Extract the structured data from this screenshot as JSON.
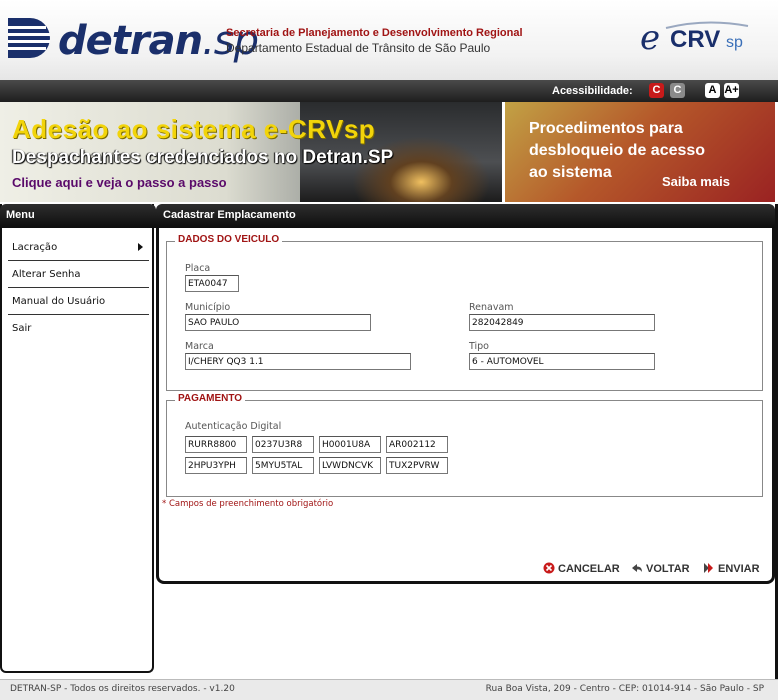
{
  "header": {
    "logo_text": "detran",
    "logo_suffix": ".sp",
    "secretaria": "Secretaria de Planejamento e Desenvolvimento Regional",
    "departamento": "Departamento Estadual de Trânsito de São Paulo",
    "ecrv_e": "e",
    "ecrv_crv": "CRV",
    "ecrv_sp": "sp"
  },
  "accessibility": {
    "label": "Acessibilidade:",
    "contrast_1": "C",
    "contrast_2": "C",
    "font_1": "A",
    "font_2": "A+"
  },
  "banners": {
    "left": {
      "line1": "Adesão ao sistema e-CRVsp",
      "line2": "Despachantes credenciados no Detran.SP",
      "line3": "Clique aqui e veja o passo a passo"
    },
    "right": {
      "line1": "Procedimentos para",
      "line2": "desbloqueio de acesso",
      "line3": "ao sistema",
      "link": "Saiba mais"
    }
  },
  "sidebar": {
    "title": "Menu",
    "items": [
      {
        "label": "Lacração",
        "has_submenu": true
      },
      {
        "label": "Alterar Senha"
      },
      {
        "label": "Manual do Usuário"
      },
      {
        "label": "Sair"
      }
    ]
  },
  "main": {
    "title": "Cadastrar Emplacamento",
    "veiculo": {
      "legend": "DADOS DO VEICULO",
      "placa_label": "Placa",
      "placa_value": "ETA0047",
      "municipio_label": "Município",
      "municipio_value": "SAO PAULO",
      "renavam_label": "Renavam",
      "renavam_value": "282042849",
      "marca_label": "Marca",
      "marca_value": "I/CHERY QQ3 1.1",
      "tipo_label": "Tipo",
      "tipo_value": "6 - AUTOMOVEL"
    },
    "pagamento": {
      "legend": "PAGAMENTO",
      "auth_label": "Autenticação Digital",
      "auth_values": [
        "RURR8800",
        "0237U3R8",
        "H0001U8A",
        "AR002112",
        "2HPU3YPH",
        "5MYU5TAL",
        "LVWDNCVK",
        "TUX2PVRW"
      ]
    },
    "required_note": "* Campos de preenchimento obrigatório",
    "actions": {
      "cancel": "CANCELAR",
      "back": "VOLTAR",
      "send": "ENVIAR"
    }
  },
  "footer": {
    "left": "DETRAN-SP - Todos os direitos reservados. - v1.20",
    "right": "Rua Boa Vista, 209 - Centro - CEP: 01014-914 - São Paulo - SP"
  },
  "colors": {
    "accent_red": "#a01414",
    "brand_blue": "#1a2f6b",
    "header_dark": "#1e1e1e"
  }
}
